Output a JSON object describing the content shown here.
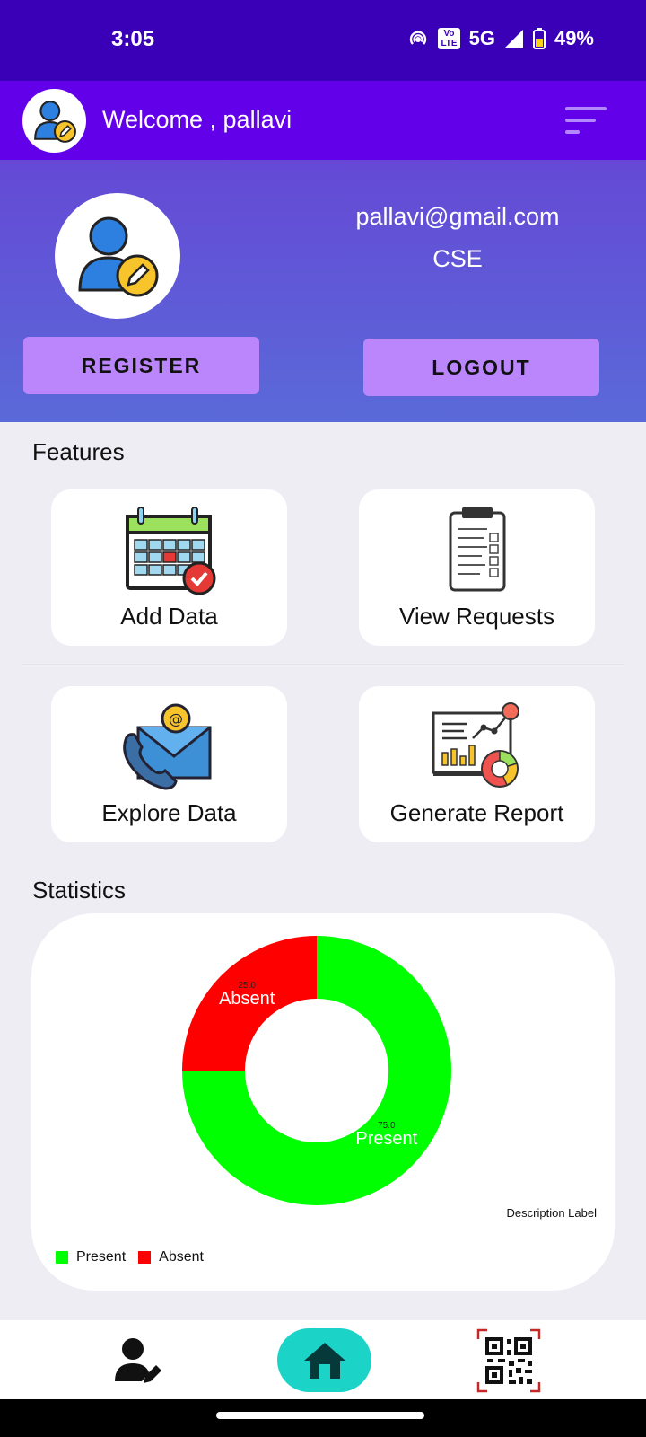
{
  "status_bar": {
    "time": "3:05",
    "network": "5G",
    "volte": "Vo LTE",
    "battery": "49%",
    "icons": [
      "hotspot-icon",
      "volte-icon",
      "signal-icon",
      "battery-icon"
    ]
  },
  "app_bar": {
    "title": "Welcome , pallavi",
    "avatar_icon": "user-edit-icon",
    "menu_icon": "filter-menu-icon"
  },
  "profile": {
    "email": "pallavi@gmail.com",
    "department": "CSE",
    "register_label": "REGISTER",
    "logout_label": "LOGOUT"
  },
  "features": {
    "title": "Features",
    "cards": [
      {
        "label": "Add Data",
        "icon": "calendar-check-icon"
      },
      {
        "label": "View Requests",
        "icon": "clipboard-checklist-icon"
      },
      {
        "label": "Explore Data",
        "icon": "phone-email-icon"
      },
      {
        "label": "Generate Report",
        "icon": "report-chart-icon"
      }
    ]
  },
  "statistics": {
    "title": "Statistics",
    "description_label": "Description Label"
  },
  "chart_data": {
    "type": "pie",
    "style": "donut",
    "categories": [
      "Present",
      "Absent"
    ],
    "values": [
      75.0,
      25.0
    ],
    "value_labels": [
      "75.0",
      "25.0"
    ],
    "colors": [
      "#00ff00",
      "#ff0000"
    ],
    "legend": [
      "Present",
      "Absent"
    ],
    "legend_position": "bottom-left",
    "description": "Description Label"
  },
  "bottom_nav": {
    "items": [
      {
        "name": "profile",
        "icon": "user-edit-icon"
      },
      {
        "name": "home",
        "icon": "home-icon",
        "active": true
      },
      {
        "name": "qr",
        "icon": "qr-code-icon"
      }
    ]
  },
  "colors": {
    "status_bar": "#3a00b8",
    "app_bar": "#6200ea",
    "button": "#bb86fc",
    "home_active": "#1bd4c7"
  }
}
